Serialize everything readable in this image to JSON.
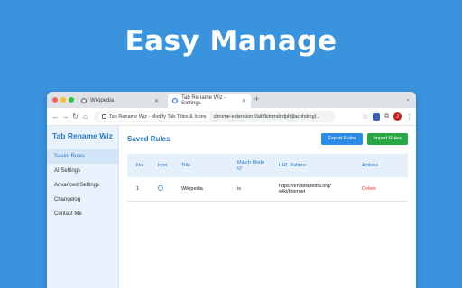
{
  "hero": {
    "title": "Easy Manage"
  },
  "browser": {
    "tabs": [
      {
        "label": "Wikipedia",
        "active": false
      },
      {
        "label": "Tab Rename Wiz - Settings",
        "active": true
      }
    ],
    "omnibox": {
      "chip_label": "Tab Rename Wiz - Modify Tab Titles & Icons",
      "url": "chrome-extension://aihfkimmdndpfdjlacnhdmgl..."
    },
    "avatar_initial": "J"
  },
  "sidebar": {
    "brand": "Tab Rename Wiz",
    "items": [
      {
        "label": "Saved Rules",
        "active": true
      },
      {
        "label": "AI Settings",
        "active": false
      },
      {
        "label": "Advanced Settings",
        "active": false
      },
      {
        "label": "Changelog",
        "active": false
      },
      {
        "label": "Contact Me",
        "active": false
      }
    ]
  },
  "main": {
    "title": "Saved Rules",
    "export_label": "Export Rules",
    "import_label": "Import Rules",
    "table": {
      "headers": {
        "no": "No.",
        "icon": "Icon",
        "title": "Title",
        "match_mode": "Match Mode",
        "url_pattern": "URL Pattern",
        "actions": "Actions"
      },
      "rows": [
        {
          "no": "1",
          "title": "Wikipedia",
          "match_mode": "is",
          "url_line1": "https://en.wikipedia.org/",
          "url_line2": "wiki/Internet",
          "action": "Delete"
        }
      ]
    }
  },
  "colors": {
    "background": "#3a93dd",
    "accent": "#2b78c5",
    "export_button": "#2b8be6",
    "import_button": "#28a745",
    "delete": "#e53935"
  }
}
